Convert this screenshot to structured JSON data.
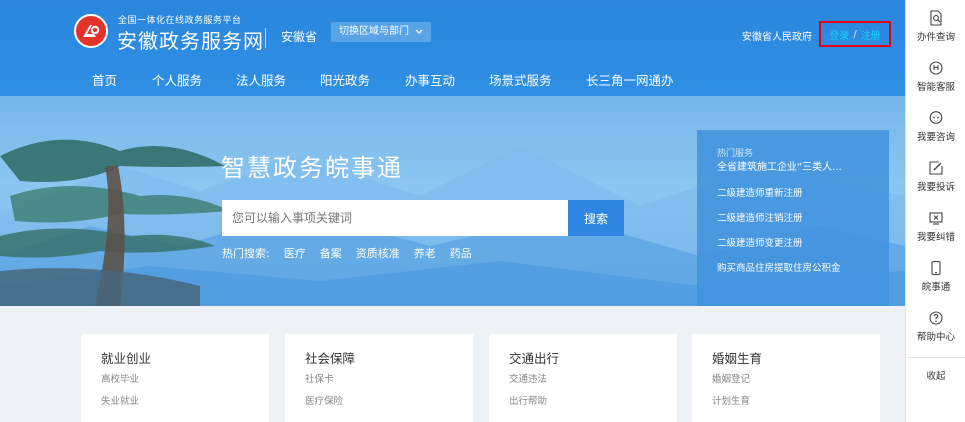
{
  "header": {
    "platform_sub": "全国一体化在线政务服务平台",
    "brand_title": "安徽政务服务网",
    "province": "安徽省",
    "switch_label": "切换区域与部门",
    "gov_link": "安徽省人民政府",
    "login": "登录",
    "auth_sep": "/",
    "register": "注册",
    "colors": {
      "brand_blue": "#2a86de",
      "logo_red": "#e5332a",
      "highlight_box": "#e60012",
      "auth_text": "#19d0ff"
    }
  },
  "nav": [
    {
      "label": "首页"
    },
    {
      "label": "个人服务"
    },
    {
      "label": "法人服务"
    },
    {
      "label": "阳光政务"
    },
    {
      "label": "办事互动"
    },
    {
      "label": "场景式服务"
    },
    {
      "label": "长三角一网通办"
    }
  ],
  "hero": {
    "title": "智慧政务皖事通",
    "search_placeholder": "您可以输入事项关键词",
    "search_button": "搜索",
    "hot_search_label": "热门搜索:",
    "hot_search_terms": [
      "医疗",
      "备案",
      "资质核准",
      "养老",
      "药品"
    ]
  },
  "hot_services": {
    "title": "热门服务",
    "items": [
      "全省建筑施工企业“三类人...",
      "二级建造师重新注册",
      "二级建造师注销注册",
      "二级建造师变更注册",
      "购买商品住房提取住房公积金"
    ]
  },
  "categories": [
    {
      "title": "就业创业",
      "items": [
        "高校毕业",
        "失业就业"
      ]
    },
    {
      "title": "社会保障",
      "items": [
        "社保卡",
        "医疗保险"
      ]
    },
    {
      "title": "交通出行",
      "items": [
        "交通违法",
        "出行帮助"
      ]
    },
    {
      "title": "婚姻生育",
      "items": [
        "婚姻登记",
        "计划生育"
      ]
    }
  ],
  "sidebar": {
    "items": [
      {
        "label": "办件查询",
        "icon": "document-search-icon"
      },
      {
        "label": "智能客服",
        "icon": "robot-icon"
      },
      {
        "label": "我要咨询",
        "icon": "chat-icon"
      },
      {
        "label": "我要投诉",
        "icon": "edit-icon"
      },
      {
        "label": "我要纠错",
        "icon": "error-report-icon"
      },
      {
        "label": "皖事通",
        "icon": "phone-icon"
      },
      {
        "label": "帮助中心",
        "icon": "help-icon"
      }
    ],
    "collapse": "收起"
  }
}
